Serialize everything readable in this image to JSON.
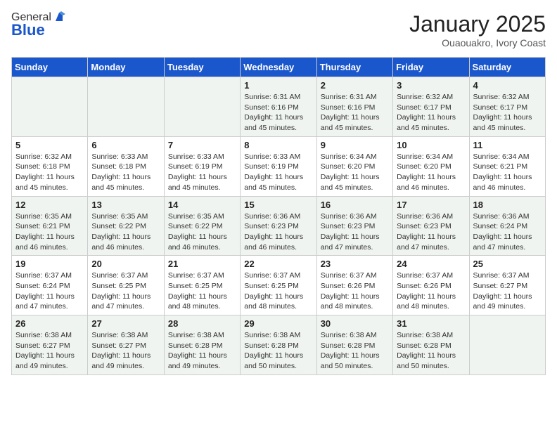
{
  "header": {
    "logo_general": "General",
    "logo_blue": "Blue",
    "title": "January 2025",
    "location": "Ouaouakro, Ivory Coast"
  },
  "days_of_week": [
    "Sunday",
    "Monday",
    "Tuesday",
    "Wednesday",
    "Thursday",
    "Friday",
    "Saturday"
  ],
  "weeks": [
    [
      {
        "day": "",
        "detail": ""
      },
      {
        "day": "",
        "detail": ""
      },
      {
        "day": "",
        "detail": ""
      },
      {
        "day": "1",
        "detail": "Sunrise: 6:31 AM\nSunset: 6:16 PM\nDaylight: 11 hours and 45 minutes."
      },
      {
        "day": "2",
        "detail": "Sunrise: 6:31 AM\nSunset: 6:16 PM\nDaylight: 11 hours and 45 minutes."
      },
      {
        "day": "3",
        "detail": "Sunrise: 6:32 AM\nSunset: 6:17 PM\nDaylight: 11 hours and 45 minutes."
      },
      {
        "day": "4",
        "detail": "Sunrise: 6:32 AM\nSunset: 6:17 PM\nDaylight: 11 hours and 45 minutes."
      }
    ],
    [
      {
        "day": "5",
        "detail": "Sunrise: 6:32 AM\nSunset: 6:18 PM\nDaylight: 11 hours and 45 minutes."
      },
      {
        "day": "6",
        "detail": "Sunrise: 6:33 AM\nSunset: 6:18 PM\nDaylight: 11 hours and 45 minutes."
      },
      {
        "day": "7",
        "detail": "Sunrise: 6:33 AM\nSunset: 6:19 PM\nDaylight: 11 hours and 45 minutes."
      },
      {
        "day": "8",
        "detail": "Sunrise: 6:33 AM\nSunset: 6:19 PM\nDaylight: 11 hours and 45 minutes."
      },
      {
        "day": "9",
        "detail": "Sunrise: 6:34 AM\nSunset: 6:20 PM\nDaylight: 11 hours and 45 minutes."
      },
      {
        "day": "10",
        "detail": "Sunrise: 6:34 AM\nSunset: 6:20 PM\nDaylight: 11 hours and 46 minutes."
      },
      {
        "day": "11",
        "detail": "Sunrise: 6:34 AM\nSunset: 6:21 PM\nDaylight: 11 hours and 46 minutes."
      }
    ],
    [
      {
        "day": "12",
        "detail": "Sunrise: 6:35 AM\nSunset: 6:21 PM\nDaylight: 11 hours and 46 minutes."
      },
      {
        "day": "13",
        "detail": "Sunrise: 6:35 AM\nSunset: 6:22 PM\nDaylight: 11 hours and 46 minutes."
      },
      {
        "day": "14",
        "detail": "Sunrise: 6:35 AM\nSunset: 6:22 PM\nDaylight: 11 hours and 46 minutes."
      },
      {
        "day": "15",
        "detail": "Sunrise: 6:36 AM\nSunset: 6:23 PM\nDaylight: 11 hours and 46 minutes."
      },
      {
        "day": "16",
        "detail": "Sunrise: 6:36 AM\nSunset: 6:23 PM\nDaylight: 11 hours and 47 minutes."
      },
      {
        "day": "17",
        "detail": "Sunrise: 6:36 AM\nSunset: 6:23 PM\nDaylight: 11 hours and 47 minutes."
      },
      {
        "day": "18",
        "detail": "Sunrise: 6:36 AM\nSunset: 6:24 PM\nDaylight: 11 hours and 47 minutes."
      }
    ],
    [
      {
        "day": "19",
        "detail": "Sunrise: 6:37 AM\nSunset: 6:24 PM\nDaylight: 11 hours and 47 minutes."
      },
      {
        "day": "20",
        "detail": "Sunrise: 6:37 AM\nSunset: 6:25 PM\nDaylight: 11 hours and 47 minutes."
      },
      {
        "day": "21",
        "detail": "Sunrise: 6:37 AM\nSunset: 6:25 PM\nDaylight: 11 hours and 48 minutes."
      },
      {
        "day": "22",
        "detail": "Sunrise: 6:37 AM\nSunset: 6:25 PM\nDaylight: 11 hours and 48 minutes."
      },
      {
        "day": "23",
        "detail": "Sunrise: 6:37 AM\nSunset: 6:26 PM\nDaylight: 11 hours and 48 minutes."
      },
      {
        "day": "24",
        "detail": "Sunrise: 6:37 AM\nSunset: 6:26 PM\nDaylight: 11 hours and 48 minutes."
      },
      {
        "day": "25",
        "detail": "Sunrise: 6:37 AM\nSunset: 6:27 PM\nDaylight: 11 hours and 49 minutes."
      }
    ],
    [
      {
        "day": "26",
        "detail": "Sunrise: 6:38 AM\nSunset: 6:27 PM\nDaylight: 11 hours and 49 minutes."
      },
      {
        "day": "27",
        "detail": "Sunrise: 6:38 AM\nSunset: 6:27 PM\nDaylight: 11 hours and 49 minutes."
      },
      {
        "day": "28",
        "detail": "Sunrise: 6:38 AM\nSunset: 6:28 PM\nDaylight: 11 hours and 49 minutes."
      },
      {
        "day": "29",
        "detail": "Sunrise: 6:38 AM\nSunset: 6:28 PM\nDaylight: 11 hours and 50 minutes."
      },
      {
        "day": "30",
        "detail": "Sunrise: 6:38 AM\nSunset: 6:28 PM\nDaylight: 11 hours and 50 minutes."
      },
      {
        "day": "31",
        "detail": "Sunrise: 6:38 AM\nSunset: 6:28 PM\nDaylight: 11 hours and 50 minutes."
      },
      {
        "day": "",
        "detail": ""
      }
    ]
  ]
}
